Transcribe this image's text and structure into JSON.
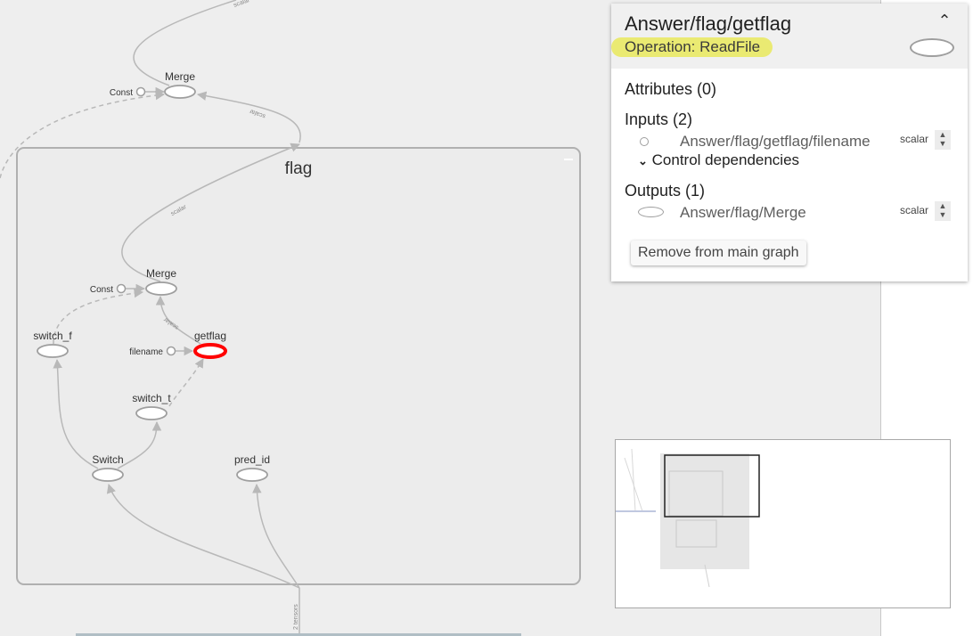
{
  "graph": {
    "group_label": "flag",
    "edge_label_scalar": "scalar",
    "edge_label_tensors": "2 tensors",
    "nodes": {
      "merge_outer": "Merge",
      "const_outer": "Const",
      "merge_inner": "Merge",
      "const_inner": "Const",
      "switch_f": "switch_f",
      "getflag": "getflag",
      "filename": "filename",
      "switch_t": "switch_t",
      "switch": "Switch",
      "pred_id": "pred_id"
    }
  },
  "info": {
    "title": "Answer/flag/getflag",
    "operation": "Operation: ReadFile",
    "attributes": "Attributes (0)",
    "inputs": "Inputs (2)",
    "input_items": [
      {
        "name": "Answer/flag/getflag/filename",
        "type": "scalar"
      }
    ],
    "control_dependencies": "Control dependencies",
    "outputs": "Outputs (1)",
    "output_items": [
      {
        "name": "Answer/flag/Merge",
        "type": "scalar"
      }
    ],
    "remove_button": "Remove from main graph"
  },
  "colors": {
    "selected_node": "#ff0000",
    "operation_highlight": "#eaea72",
    "node_stroke": "#9e9e9e",
    "edge": "#b8b8b8"
  }
}
